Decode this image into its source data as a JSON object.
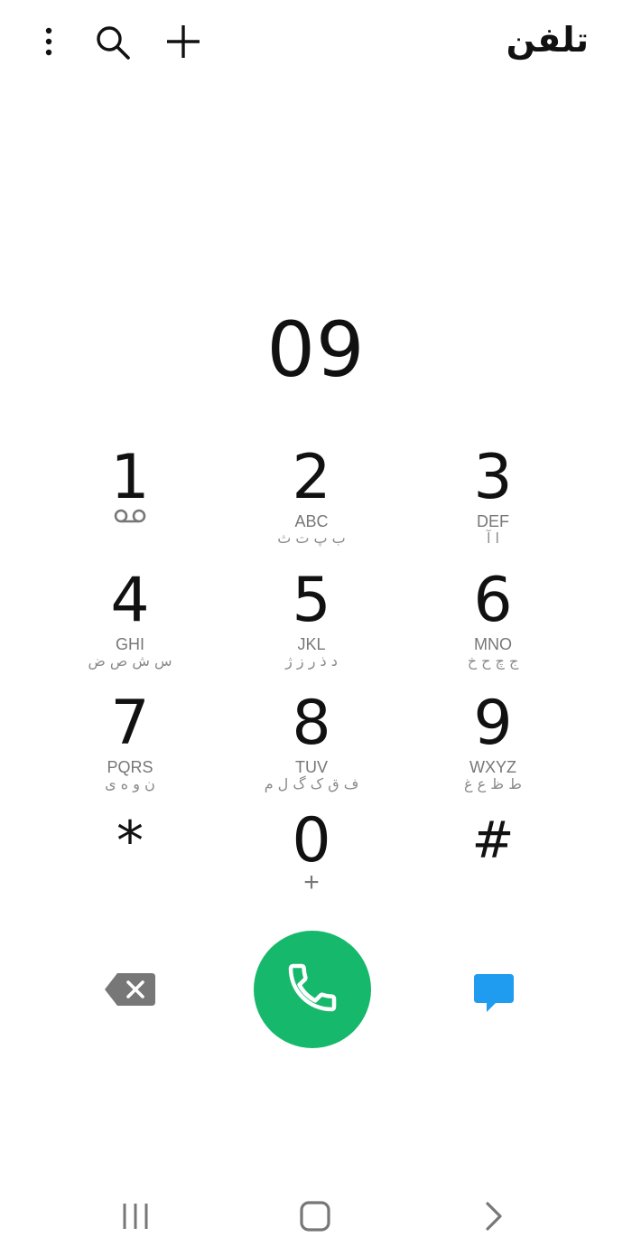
{
  "header": {
    "title": "تلفن",
    "icons": [
      "more-vertical-icon",
      "search-icon",
      "add-icon"
    ]
  },
  "dial_number": "09",
  "keypad": [
    {
      "digit": "1",
      "letters": "",
      "farsi": "",
      "sub_icon": "voicemail-icon"
    },
    {
      "digit": "2",
      "letters": "ABC",
      "farsi": "ب پ ت ث"
    },
    {
      "digit": "3",
      "letters": "DEF",
      "farsi": "ا آ"
    },
    {
      "digit": "4",
      "letters": "GHI",
      "farsi": "س ش ص ض"
    },
    {
      "digit": "5",
      "letters": "JKL",
      "farsi": "د ذ ر ز ژ"
    },
    {
      "digit": "6",
      "letters": "MNO",
      "farsi": "ج چ ح خ"
    },
    {
      "digit": "7",
      "letters": "PQRS",
      "farsi": "ن و ه ی"
    },
    {
      "digit": "8",
      "letters": "TUV",
      "farsi": "ف ق ک گ ل م"
    },
    {
      "digit": "9",
      "letters": "WXYZ",
      "farsi": "ط ظ ع غ"
    },
    {
      "digit": "*",
      "letters": "",
      "farsi": ""
    },
    {
      "digit": "0",
      "letters": "+",
      "farsi": ""
    },
    {
      "digit": "#",
      "letters": "",
      "farsi": ""
    }
  ],
  "actions": {
    "backspace_icon": "backspace-icon",
    "call_icon": "phone-icon",
    "message_icon": "message-icon"
  },
  "colors": {
    "call_green": "#16b86b",
    "message_blue": "#1f9bf0",
    "backspace_gray": "#777777"
  },
  "navbar": [
    "recent-apps-icon",
    "home-icon",
    "back-icon"
  ]
}
